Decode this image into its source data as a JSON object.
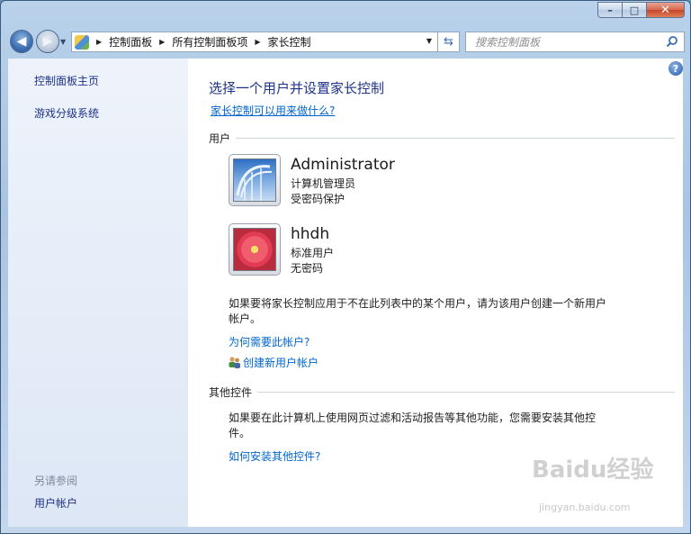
{
  "window": {
    "minimize_glyph": "–",
    "maximize_glyph": "□",
    "close_glyph": "✕"
  },
  "nav": {
    "back_icon": "back-arrow-icon",
    "forward_icon": "forward-arrow-icon",
    "breadcrumb": [
      "控制面板",
      "所有控制面板项",
      "家长控制"
    ],
    "search_placeholder": "搜索控制面板"
  },
  "sidebar": {
    "links": [
      "控制面板主页",
      "游戏分级系统"
    ],
    "see_also_heading": "另请参阅",
    "see_also_links": [
      "用户帐户"
    ]
  },
  "main": {
    "title": "选择一个用户并设置家长控制",
    "what_link": "家长控制可以用来做什么?",
    "users_heading": "用户",
    "users": [
      {
        "name": "Administrator",
        "type": "计算机管理员",
        "password": "受密码保护",
        "picture": "roller-coaster"
      },
      {
        "name": "hhdh",
        "type": "标准用户",
        "password": "无密码",
        "picture": "flower"
      }
    ],
    "new_user_text": "如果要将家长控制应用于不在此列表中的某个用户，请为该用户创建一个新用户帐户。",
    "why_account_link": "为何需要此帐户?",
    "create_user_link": "创建新用户帐户",
    "other_controls_heading": "其他控件",
    "other_controls_text": "如果要在此计算机上使用网页过滤和活动报告等其他功能，您需要安装其他控件。",
    "install_link": "如何安装其他控件?"
  },
  "watermark": {
    "brand": "Baidu经验",
    "url": "jingyan.baidu.com"
  },
  "colors": {
    "link": "#0066cc",
    "heading": "#1e3287",
    "sidebar_bg": "#e4ecf8"
  }
}
